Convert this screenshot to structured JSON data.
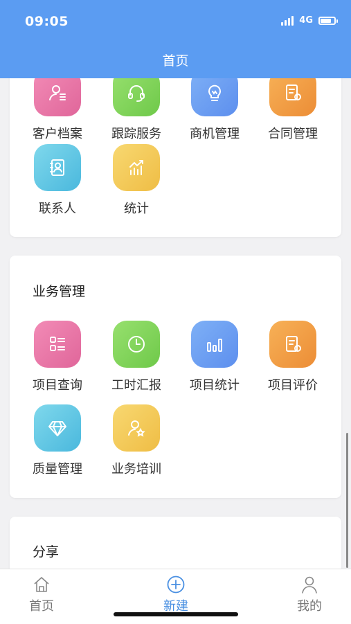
{
  "status_bar": {
    "time": "09:05",
    "network": "4G"
  },
  "header": {
    "title": "首页"
  },
  "section_top": {
    "items": [
      {
        "label": "客户档案",
        "icon": "customer-icon"
      },
      {
        "label": "跟踪服务",
        "icon": "headset-icon"
      },
      {
        "label": "商机管理",
        "icon": "lightbulb-icon"
      },
      {
        "label": "合同管理",
        "icon": "contract-icon"
      },
      {
        "label": "联系人",
        "icon": "contact-book-icon"
      },
      {
        "label": "统计",
        "icon": "stats-icon"
      }
    ]
  },
  "section_business": {
    "title": "业务管理",
    "items": [
      {
        "label": "项目查询",
        "icon": "list-grid-icon"
      },
      {
        "label": "工时汇报",
        "icon": "clock-icon"
      },
      {
        "label": "项目统计",
        "icon": "bar-chart-icon"
      },
      {
        "label": "项目评价",
        "icon": "evaluation-icon"
      },
      {
        "label": "质量管理",
        "icon": "diamond-icon"
      },
      {
        "label": "业务培训",
        "icon": "trainer-icon"
      }
    ]
  },
  "section_share": {
    "title": "分享"
  },
  "tabbar": {
    "tabs": [
      {
        "label": "首页",
        "icon": "home-icon"
      },
      {
        "label": "新建",
        "icon": "plus-circle-icon",
        "active": true
      },
      {
        "label": "我的",
        "icon": "user-icon"
      }
    ]
  },
  "colors": {
    "header": "#5b9cf2",
    "active_tab": "#4a90e2"
  }
}
